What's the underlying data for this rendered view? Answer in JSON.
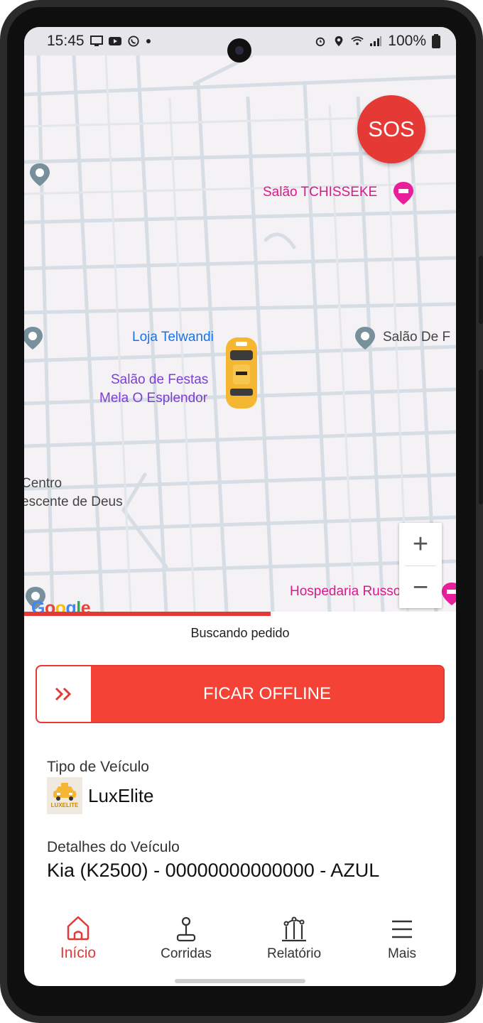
{
  "status_bar": {
    "time": "15:45",
    "left_icons": [
      "monitor-icon",
      "youtube-icon",
      "whatsapp-icon",
      "dot-icon"
    ],
    "right_icons": [
      "alarm-icon",
      "location-icon",
      "wifi-icon",
      "signal-icon",
      "battery-icon"
    ],
    "battery": "100%"
  },
  "map": {
    "sos_label": "SOS",
    "poi": [
      {
        "label": "Salão TCHISSEKE",
        "color": "#d81b8a"
      },
      {
        "label": "Loja Telwandi",
        "color": "#1a73e8"
      },
      {
        "label": "Salão De F",
        "color": "#444444"
      },
      {
        "label": "Salão de Festas",
        "color": "#7b3fd1"
      },
      {
        "label": "Mela O Esplendor",
        "color": "#7b3fd1"
      },
      {
        "label": "Centro",
        "color": "#444444"
      },
      {
        "label": "escente de Deus",
        "color": "#444444"
      },
      {
        "label": "Hospedaria Russoriel",
        "color": "#d81b8a"
      }
    ],
    "zoom_in": "+",
    "zoom_out": "−",
    "attribution": "Google"
  },
  "search_progress": 0.57,
  "searching_label": "Buscando pedido",
  "offline_button": {
    "label": "FICAR OFFLINE",
    "handle_icon": "double-chevron-right-icon"
  },
  "vehicle": {
    "type_label": "Tipo de Veículo",
    "type_logo_text": "LUXELITE",
    "type_name": "LuxElite",
    "details_label": "Detalhes do Veículo",
    "details_value": "Kia (K2500) - 00000000000000 - AZUL"
  },
  "nav": {
    "items": [
      {
        "label": "Início",
        "icon": "home-icon",
        "active": true
      },
      {
        "label": "Corridas",
        "icon": "joystick-icon",
        "active": false
      },
      {
        "label": "Relatório",
        "icon": "report-icon",
        "active": false
      },
      {
        "label": "Mais",
        "icon": "menu-icon",
        "active": false
      }
    ]
  },
  "colors": {
    "accent": "#e53935",
    "button": "#f44336"
  }
}
